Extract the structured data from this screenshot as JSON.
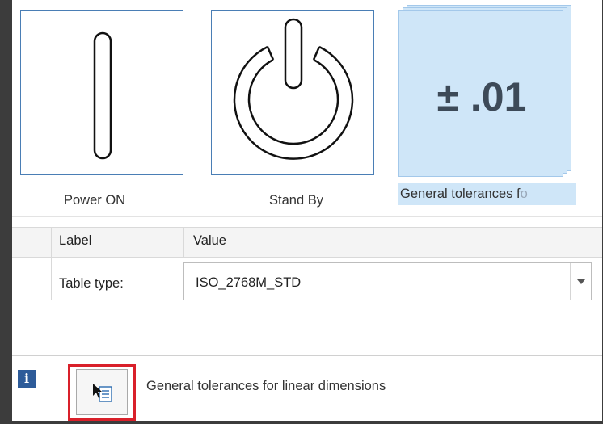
{
  "tiles": [
    {
      "label": "Power ON",
      "icon": "power-on-icon"
    },
    {
      "label": "Stand By",
      "icon": "standby-power-icon"
    },
    {
      "label": "General tolerances fo",
      "label_visible": "General tolerances f",
      "label_faded": "o",
      "icon_text": "± .01",
      "selected": true
    }
  ],
  "table": {
    "headers": {
      "label": "Label",
      "value": "Value"
    },
    "rows": [
      {
        "label": "Table type:",
        "value": "ISO_2768M_STD"
      }
    ]
  },
  "status": {
    "info_icon": "i",
    "text": "General tolerances for linear dimensions"
  },
  "colors": {
    "tile_border": "#4a7eb5",
    "selected_bg": "#cfe6f8",
    "highlight": "#d9202a"
  }
}
